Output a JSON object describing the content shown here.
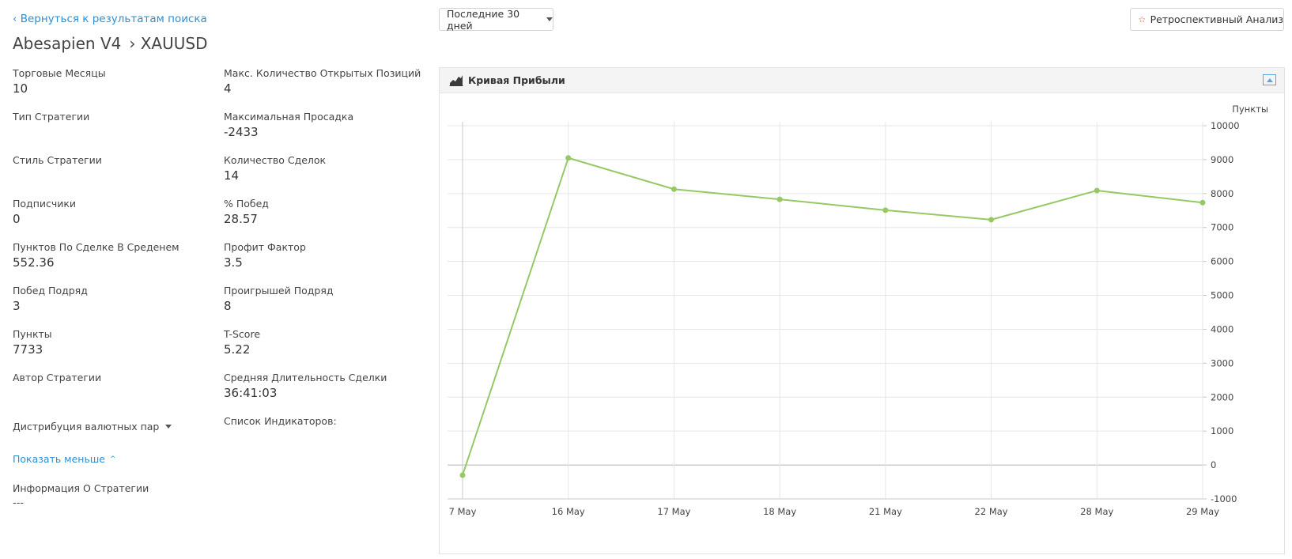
{
  "nav": {
    "back_link": "‹ Вернуться к результатам поиска"
  },
  "header": {
    "strategy_name": "Abesapien V4",
    "symbol": "› XAUUSD"
  },
  "period_select": {
    "value": "Последние 30 дней"
  },
  "retro_button": {
    "label": "Ретроспективный Анализ",
    "icon": "star-outline-icon",
    "icon_color": "#e57f5f"
  },
  "stats": {
    "trading_months": {
      "label": "Торговые Месяцы",
      "value": "10"
    },
    "max_open_positions": {
      "label": "Макс. Количество Открытых Позиций",
      "value": "4"
    },
    "strategy_type": {
      "label": "Тип Стратегии",
      "value": ""
    },
    "max_drawdown": {
      "label": "Максимальная Просадка",
      "value": "-2433"
    },
    "strategy_style": {
      "label": "Стиль Стратегии",
      "value": ""
    },
    "trades_count": {
      "label": "Количество Сделок",
      "value": "14"
    },
    "subscribers": {
      "label": "Подписчики",
      "value": "0"
    },
    "win_percent": {
      "label": "% Побед",
      "value": "28.57"
    },
    "avg_points_per_trade": {
      "label": "Пунктов По Сделке В Среденем",
      "value": "552.36"
    },
    "profit_factor": {
      "label": "Профит Фактор",
      "value": "3.5"
    },
    "wins_in_row": {
      "label": "Побед Подряд",
      "value": "3"
    },
    "losses_in_row": {
      "label": "Проигрышей Подряд",
      "value": "8"
    },
    "points": {
      "label": "Пункты",
      "value": "7733"
    },
    "t_score": {
      "label": "T-Score",
      "value": "5.22"
    },
    "strategy_author": {
      "label": "Автор Стратегии",
      "value": ""
    },
    "avg_trade_duration": {
      "label": "Средняя Длительность Сделки",
      "value": "36:41:03"
    }
  },
  "currency_distribution": {
    "label": "Дистрибуция валютных пар"
  },
  "indicators": {
    "label": "Список Индикаторов:"
  },
  "show_less": {
    "label": "Показать меньше",
    "chevron": "^"
  },
  "strategy_info": {
    "label": "Информация О Стратегии",
    "value": "---"
  },
  "chart_panel": {
    "title": "Кривая Прибыли",
    "icon": "area-chart-icon",
    "collapse_icon": "collapse-up-icon"
  },
  "chart_data": {
    "type": "line",
    "categories": [
      "7 May",
      "16 May",
      "17 May",
      "18 May",
      "21 May",
      "22 May",
      "28 May",
      "29 May"
    ],
    "series": [
      {
        "values": [
          -300,
          9050,
          8130,
          7830,
          7510,
          7230,
          8090,
          7733
        ]
      }
    ],
    "ylabel": "Пункты",
    "ylim": [
      -1000,
      10000
    ],
    "yticks": [
      -1000,
      0,
      1000,
      2000,
      3000,
      4000,
      5000,
      6000,
      7000,
      8000,
      9000,
      10000
    ],
    "y_axis_side": "right",
    "grid": true,
    "line_color": "#96c864"
  }
}
